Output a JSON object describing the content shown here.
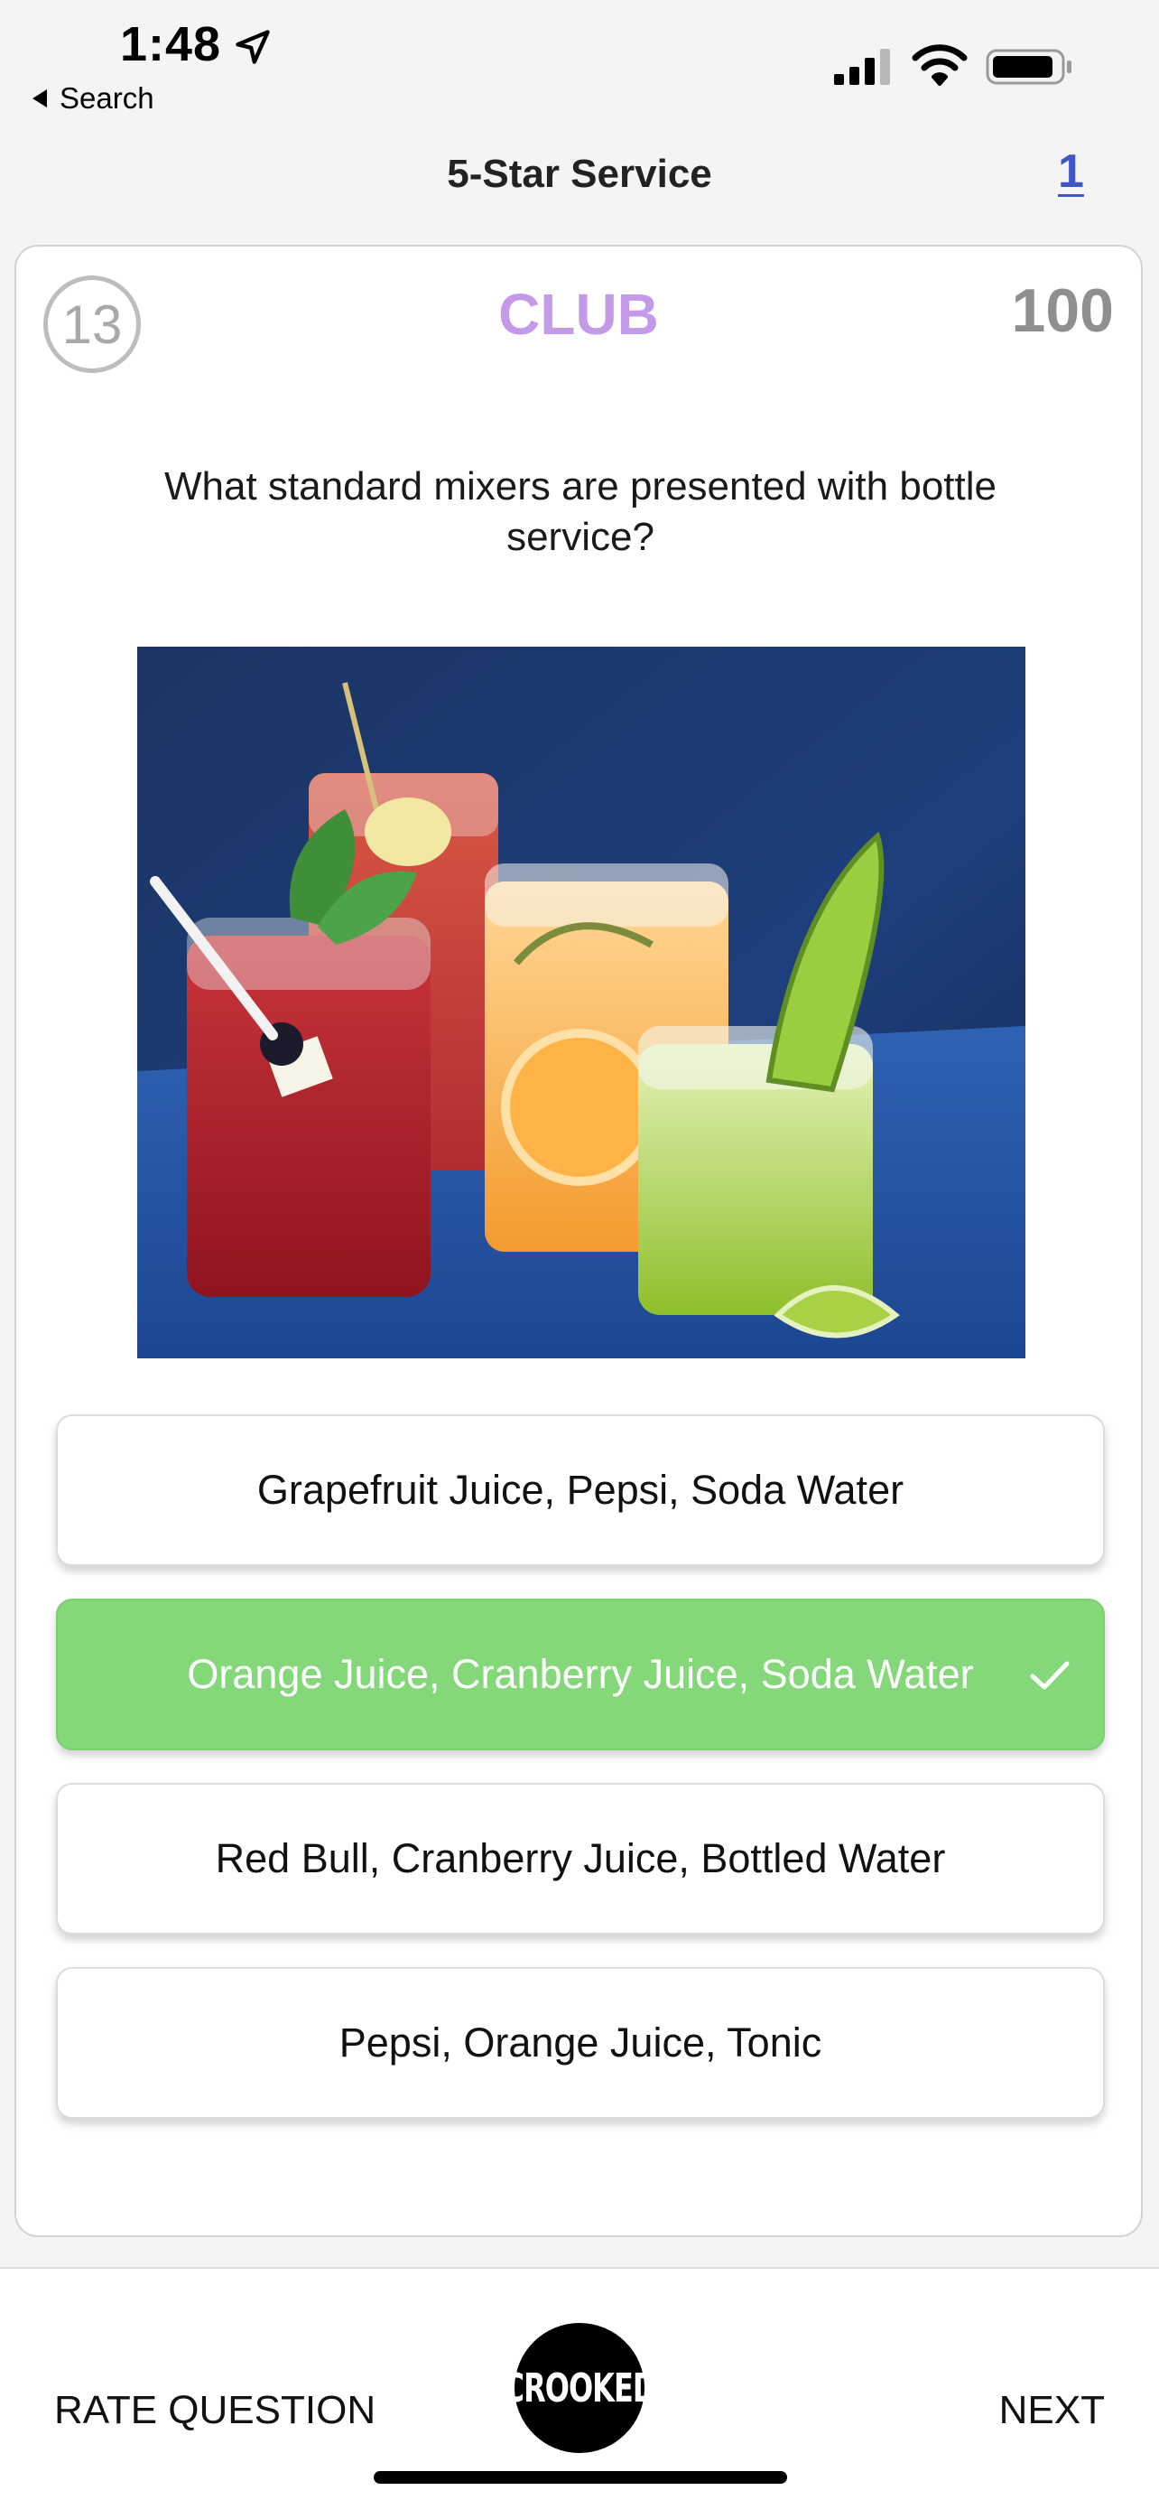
{
  "status_bar": {
    "time": "1:48",
    "back_label": "Search",
    "icons": [
      "location-arrow-icon",
      "signal-icon",
      "wifi-icon",
      "battery-icon"
    ]
  },
  "nav": {
    "title": "5-Star Service",
    "rank": "1"
  },
  "question_card": {
    "timer": "13",
    "category": "CLUB",
    "points": "100",
    "question": "What standard mixers are presented with bottle service?",
    "image": "cocktails-photo"
  },
  "answers": [
    {
      "label": "Grapefruit Juice, Pepsi, Soda Water",
      "state": "default"
    },
    {
      "label": "Orange Juice, Cranberry Juice, Soda Water",
      "state": "correct"
    },
    {
      "label": "Red Bull, Cranberry Juice, Bottled Water",
      "state": "default"
    },
    {
      "label": "Pepsi, Orange Juice, Tonic",
      "state": "default"
    }
  ],
  "bottom_bar": {
    "rate_label": "RATE QUESTION",
    "logo_text": "CROOKED",
    "next_label": "NEXT"
  },
  "colors": {
    "category": "#c49ae8",
    "correct": "#84d87a",
    "rank_link": "#3f56c6"
  }
}
